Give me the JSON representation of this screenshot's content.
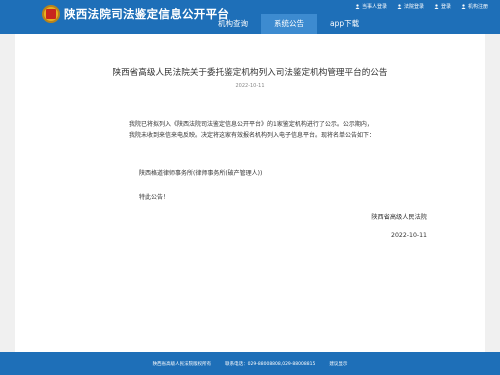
{
  "header": {
    "site_title": "陕西法院司法鉴定信息公开平台",
    "top_links": [
      "当事人登录",
      "法院登录",
      "登录",
      "机构注册"
    ],
    "nav": [
      {
        "label": "机构查询",
        "active": false
      },
      {
        "label": "系统公告",
        "active": true
      },
      {
        "label": "app下载",
        "active": false
      }
    ]
  },
  "article": {
    "title": "陕西省高级人民法院关于委托鉴定机构列入司法鉴定机构管理平台的公告",
    "date": "2022-10-11",
    "paragraph": "我院已将拟列入《陕西法院司法鉴定信息公开平台》的1家鉴定机构进行了公示。公示期内，我院未收到来信来电反映。决定将这家有效报名机构列入电子信息平台。现将名单公告如下：",
    "institution": "陕西格道律师事务所(律师事务所(破产管理人))",
    "closing": "特此公告！",
    "signer": "陕西省高级人民法院",
    "sign_date": "2022-10-11"
  },
  "footer": {
    "owner": "陕西省高级人民法院版权所有",
    "phone": "联系电话：029-88008808,029-88008815",
    "extra": "建议显示"
  },
  "colors": {
    "primary": "#1e6fb8",
    "nav_active": "#3d8bd0"
  }
}
